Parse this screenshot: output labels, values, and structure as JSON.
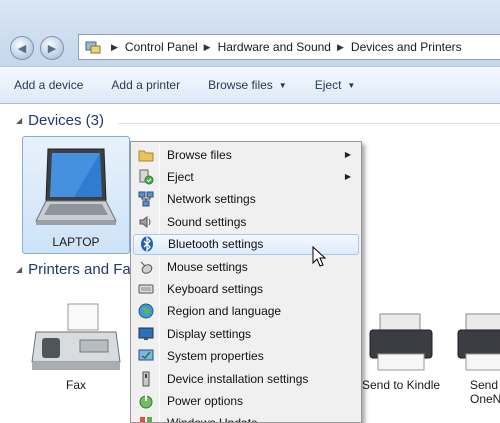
{
  "address": {
    "breadcrumbs": [
      "Control Panel",
      "Hardware and Sound",
      "Devices and Printers"
    ]
  },
  "toolbar": {
    "add_device": "Add a device",
    "add_printer": "Add a printer",
    "browse_files": "Browse files",
    "eject": "Eject"
  },
  "groups": {
    "devices": "Devices (3)",
    "printers": "Printers and Fa"
  },
  "devices": {
    "laptop": "LAPTOP"
  },
  "printers": {
    "fax": "Fax",
    "kindle": "Send to Kindle",
    "onenote": "Send\nOneN"
  },
  "menu": {
    "items": [
      {
        "label": "Browse files",
        "icon": "folder-icon",
        "submenu": true
      },
      {
        "label": "Eject",
        "icon": "eject-icon",
        "submenu": true
      },
      {
        "label": "Network settings",
        "icon": "network-icon",
        "submenu": false
      },
      {
        "label": "Sound settings",
        "icon": "speaker-icon",
        "submenu": false
      },
      {
        "label": "Bluetooth settings",
        "icon": "bluetooth-icon",
        "submenu": false,
        "highlighted": true
      },
      {
        "label": "Mouse settings",
        "icon": "mouse-icon",
        "submenu": false
      },
      {
        "label": "Keyboard settings",
        "icon": "keyboard-icon",
        "submenu": false
      },
      {
        "label": "Region and language",
        "icon": "globe-icon",
        "submenu": false
      },
      {
        "label": "Display settings",
        "icon": "monitor-icon",
        "submenu": false
      },
      {
        "label": "System properties",
        "icon": "system-icon",
        "submenu": false
      },
      {
        "label": "Device installation settings",
        "icon": "device-install-icon",
        "submenu": false
      },
      {
        "label": "Power options",
        "icon": "power-icon",
        "submenu": false
      },
      {
        "label": "Windows Update",
        "icon": "windows-update-icon",
        "submenu": false
      }
    ]
  },
  "colors": {
    "group_heading": "#1e3a6e",
    "toolbar_text": "#1e395b",
    "selection": "#cde3f8",
    "menu_highlight": "#ddebfa"
  }
}
